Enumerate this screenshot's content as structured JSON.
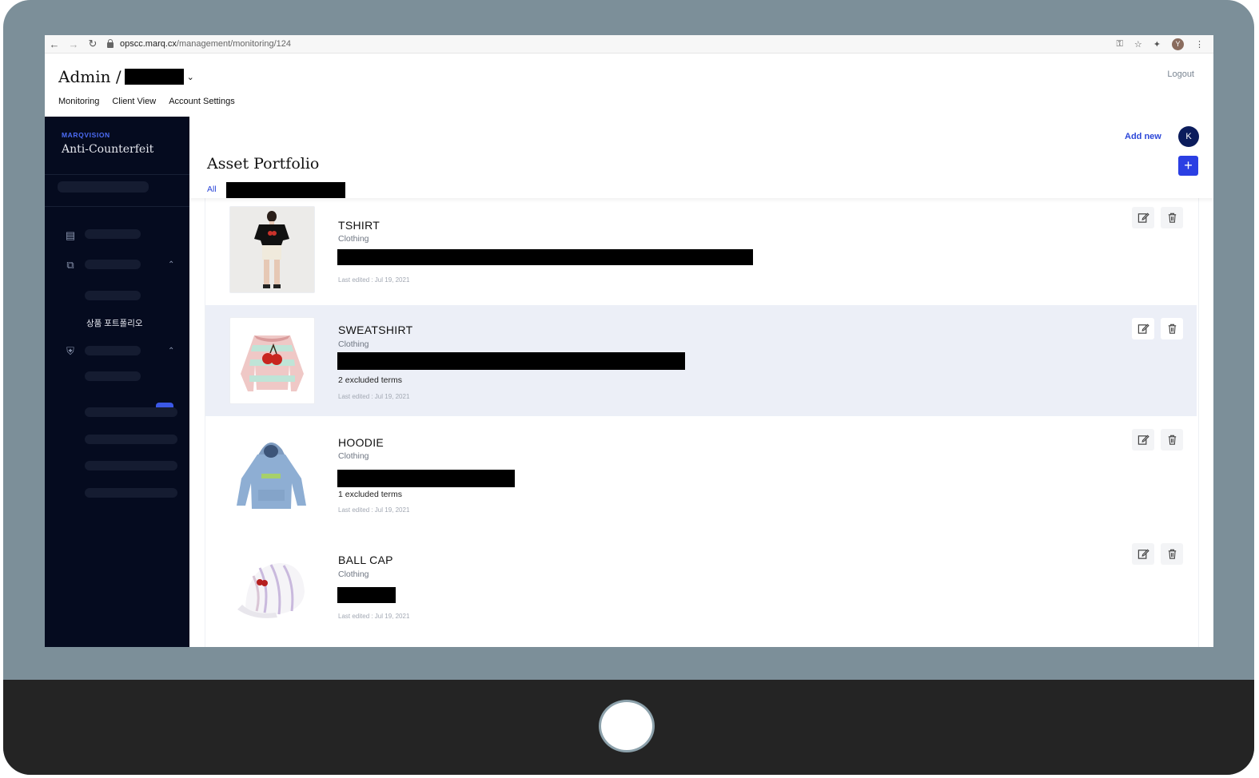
{
  "browser": {
    "url_host": "opscc.marq.cx",
    "url_path": "/management/monitoring/124",
    "profile_initial": "Y"
  },
  "header": {
    "admin_label": "Admin /",
    "logout": "Logout",
    "nav": [
      "Monitoring",
      "Client View",
      "Account Settings"
    ]
  },
  "sidebar": {
    "brand_small": "MARQVISION",
    "brand_big": "Anti-Counterfeit",
    "active_item": "상품 포트폴리오"
  },
  "main": {
    "add_new": "Add new",
    "avatar_initial": "K",
    "title": "Asset Portfolio",
    "tab_all": "All",
    "plus": "+"
  },
  "items": [
    {
      "name": "TSHIRT",
      "category": "Clothing",
      "excluded": "",
      "edited": "Last edited : Jul 19, 2021"
    },
    {
      "name": "SWEATSHIRT",
      "category": "Clothing",
      "excluded": "2 excluded terms",
      "edited": "Last edited : Jul 19, 2021"
    },
    {
      "name": "HOODIE",
      "category": "Clothing",
      "excluded": "1 excluded terms",
      "edited": "Last edited : Jul 19, 2021"
    },
    {
      "name": "BALL CAP",
      "category": "Clothing",
      "excluded": "",
      "edited": "Last edited : Jul 19, 2021"
    }
  ],
  "colors": {
    "accent": "#2b3fe3",
    "sidebar_bg": "#050b1f",
    "highlight_row": "#eceff7",
    "device_frame": "#7c8f99"
  }
}
